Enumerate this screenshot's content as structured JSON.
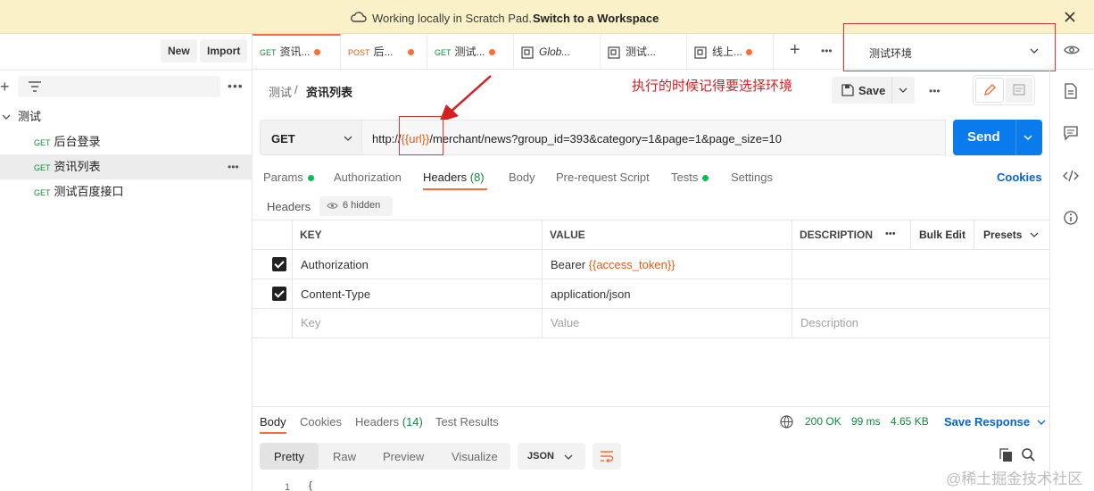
{
  "banner": {
    "text": "Working locally in Scratch Pad.",
    "link": "Switch to a Workspace"
  },
  "sidebar": {
    "new_label": "New",
    "import_label": "Import",
    "collection": "测试",
    "items": [
      {
        "method": "GET",
        "name": "后台登录"
      },
      {
        "method": "GET",
        "name": "资讯列表"
      },
      {
        "method": "GET",
        "name": "测试百度接口"
      }
    ]
  },
  "tabs": [
    {
      "method": "GET",
      "name": "资讯...",
      "dot": true
    },
    {
      "method": "POST",
      "name": "后...",
      "dot": true
    },
    {
      "method": "GET",
      "name": "测试...",
      "dot": true
    },
    {
      "method": "",
      "name": "Glob...",
      "dot": false
    },
    {
      "method": "",
      "name": "测试...",
      "dot": false
    },
    {
      "method": "",
      "name": "线上...",
      "dot": true
    }
  ],
  "environment": {
    "selected": "测试环境"
  },
  "breadcrumb": {
    "parent": "测试",
    "current": "资讯列表"
  },
  "annotation": "执行的时候记得要选择环境",
  "toolbar": {
    "save_label": "Save"
  },
  "request": {
    "method": "GET",
    "url_prefix": "http://",
    "url_var": "{{url}}",
    "url_rest": "/merchant/news?group_id=393&category=1&page=1&page_size=10",
    "send_label": "Send"
  },
  "request_tabs": [
    {
      "label": "Params",
      "dot": true
    },
    {
      "label": "Authorization",
      "dot": false
    },
    {
      "label": "Headers (8)",
      "dot": false
    },
    {
      "label": "Body",
      "dot": false
    },
    {
      "label": "Pre-request Script",
      "dot": false
    },
    {
      "label": "Tests",
      "dot": true
    },
    {
      "label": "Settings",
      "dot": false
    }
  ],
  "cookies_label": "Cookies",
  "headers_section": {
    "title": "Headers",
    "hidden": "6 hidden"
  },
  "headers_table": {
    "columns": {
      "key": "KEY",
      "value": "VALUE",
      "description": "DESCRIPTION",
      "bulk_edit": "Bulk Edit",
      "presets": "Presets"
    },
    "rows": [
      {
        "key": "Authorization",
        "value_prefix": "Bearer ",
        "value_var": "{{access_token}}"
      },
      {
        "key": "Content-Type",
        "value_prefix": "application/json",
        "value_var": ""
      }
    ],
    "placeholders": {
      "key": "Key",
      "value": "Value",
      "description": "Description"
    }
  },
  "response": {
    "tabs": [
      "Body",
      "Cookies",
      "Headers (14)",
      "Test Results"
    ],
    "status": "200 OK",
    "time": "99 ms",
    "size": "4.65 KB",
    "save_label": "Save Response",
    "view_tabs": [
      "Pretty",
      "Raw",
      "Preview",
      "Visualize"
    ],
    "format": "JSON",
    "line_number": "1",
    "first_char": "{"
  },
  "watermark": "@稀土掘金技术社区",
  "colors": {
    "accent": "#ff6c37",
    "send": "#097bed",
    "banner": "#fbf1c9",
    "annotation": "#d32020"
  }
}
